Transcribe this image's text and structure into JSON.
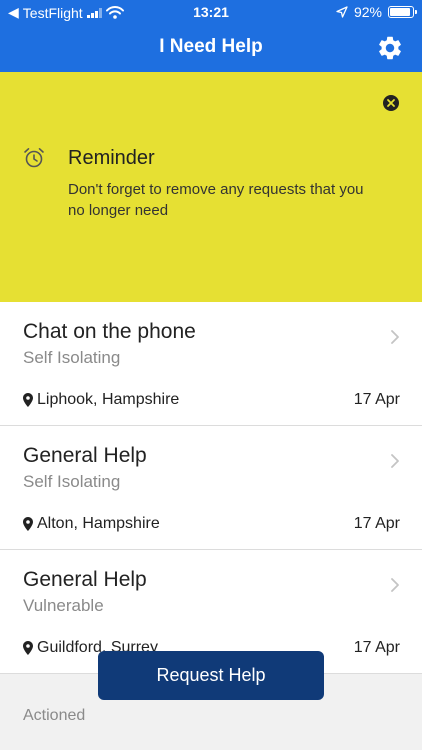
{
  "status_bar": {
    "back_app": "TestFlight",
    "time": "13:21",
    "battery_percent": "92%",
    "battery_level": 0.92
  },
  "header": {
    "title": "I Need Help",
    "settings_icon": "gear-icon"
  },
  "reminder": {
    "title": "Reminder",
    "text": "Don't forget to remove any requests that you no longer need",
    "background": "#e6e033"
  },
  "requests": [
    {
      "title": "Chat on the phone",
      "status": "Self Isolating",
      "location": "Liphook, Hampshire",
      "date": "17 Apr"
    },
    {
      "title": "General Help",
      "status": "Self Isolating",
      "location": "Alton, Hampshire",
      "date": "17 Apr"
    },
    {
      "title": "General Help",
      "status": "Vulnerable",
      "location": "Guildford, Surrey",
      "date": "17 Apr"
    }
  ],
  "actioned_label": "Actioned",
  "request_button": "Request Help",
  "colors": {
    "header": "#1e6fe0",
    "button": "#103a78"
  }
}
